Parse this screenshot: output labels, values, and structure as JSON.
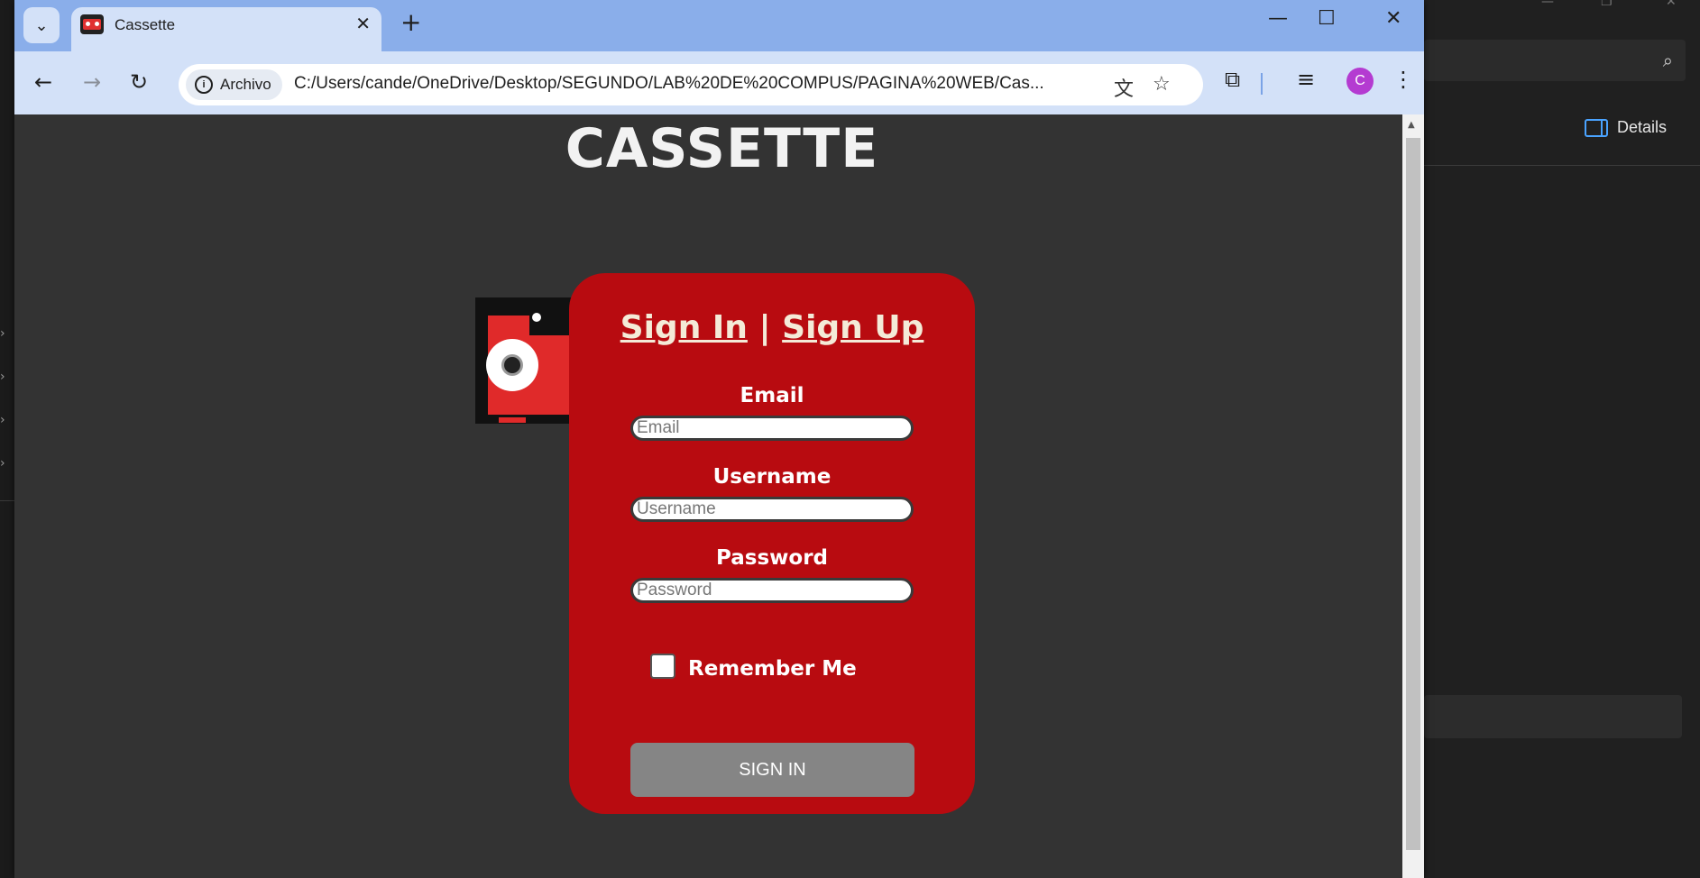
{
  "background_app": {
    "details_label": "Details"
  },
  "browser": {
    "tab": {
      "title": "Cassette"
    },
    "address": {
      "security_chip": "Archivo",
      "url": "C:/Users/cande/OneDrive/Desktop/SEGUNDO/LAB%20DE%20COMPUS/PAGINA%20WEB/Cas..."
    },
    "profile_initial": "C"
  },
  "page": {
    "site_title": "CASSETTE",
    "auth": {
      "sign_in_link": "Sign In",
      "separator": "|",
      "sign_up_link": "Sign Up"
    },
    "form": {
      "email_label": "Email",
      "email_placeholder": "Email",
      "username_label": "Username",
      "username_placeholder": "Username",
      "password_label": "Password",
      "password_placeholder": "Password",
      "remember_label": "Remember Me",
      "remember_checked": false,
      "submit_label": "SIGN IN"
    }
  },
  "colors": {
    "card": "#b80b10",
    "page_bg": "#333333",
    "tabbar": "#8aaeea",
    "toolbar": "#d3e1f8",
    "button": "#858585"
  }
}
